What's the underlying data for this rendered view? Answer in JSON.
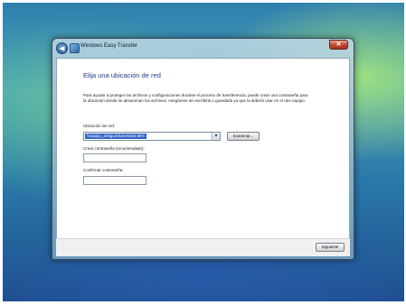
{
  "window": {
    "title": "Windows Easy Transfer",
    "close_glyph": "✕",
    "back_glyph": "◀"
  },
  "content": {
    "heading": "Elija una ubicación de red",
    "paragraph": "Para ayudar a proteger los archivos y configuraciones durante el proceso de transferencia, puede crear una contraseña para la ubicación donde se almacenan los archivos. Asegúrese de escribirla o guardarla ya que la deberá usar en el otro equipo.",
    "location_label": "Ubicación de red:",
    "location_value": "\\\\equipo_antiguo\\SaveData.MIG",
    "browse_button": "Examinar...",
    "create_password_label": "Crear contraseña (recomendado):",
    "create_password_value": "",
    "confirm_password_label": "Confirmar contraseña:",
    "confirm_password_value": ""
  },
  "footer": {
    "next_button": "Siguiente"
  },
  "icons": {
    "back": "back-arrow-icon",
    "app": "windows-easy-transfer-icon",
    "close": "close-icon",
    "dropdown": "chevron-down-icon"
  }
}
